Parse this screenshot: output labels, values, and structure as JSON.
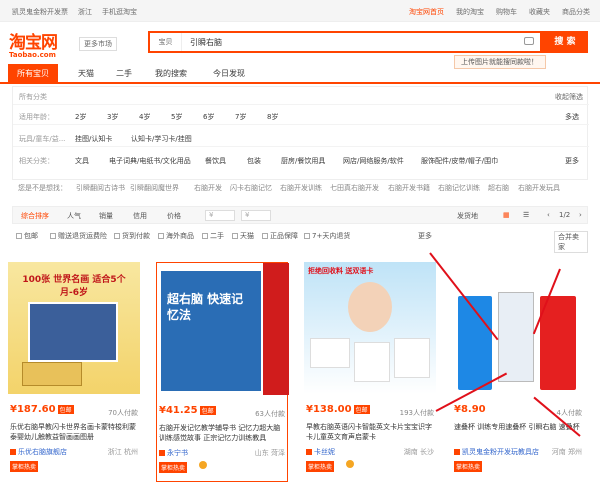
{
  "topbar": {
    "left": [
      "凯灵鬼金粉开发票",
      "浙江",
      "手机逛淘宝"
    ],
    "right": [
      "淘宝网首页",
      "我的淘宝",
      "购物车",
      "收藏夹",
      "商品分类"
    ]
  },
  "logo": {
    "main": "淘宝网",
    "sub": "Taobao.com"
  },
  "market_label": "更多市场",
  "search": {
    "category": "宝贝",
    "query": "引瞬右脑",
    "button": "搜 索"
  },
  "upload_tip": "上传图片就能搜同款啦！",
  "tabs": [
    "所有宝贝",
    "天猫",
    "二手",
    "我的搜索",
    "今日发现"
  ],
  "filter": {
    "all_label": "所有分类",
    "collapse_label": "收起筛选",
    "rows": [
      {
        "label": "适用年龄：",
        "values": [
          "2岁",
          "3岁",
          "4岁",
          "5岁",
          "6岁",
          "7岁",
          "8岁"
        ],
        "extra": "多选"
      },
      {
        "label": "玩具/童车/益...",
        "values": [
          "挂图/认知卡",
          "认知卡/学习卡/挂图"
        ],
        "extra": ""
      },
      {
        "label": "相关分类：",
        "values": [
          "文具",
          "电子词典/电纸书/文化用品",
          "餐饮具",
          "包装",
          "厨房/餐饮用具",
          "网店/网络服务/软件",
          "服饰配件/皮带/帽子/围巾"
        ],
        "extra": "更多"
      }
    ]
  },
  "guess": {
    "label": "您是不是想找：",
    "items": [
      "引瞬翻阅古诗书",
      "引瞬翻阅魔世界",
      "右脑开发",
      "闪卡右脑记忆",
      "右脑开发训练",
      "七田真右脑开发",
      "右脑开发书籍",
      "右脑记忆训练",
      "超右脑",
      "右脑开发玩具"
    ]
  },
  "sort": {
    "items": [
      "综合排序",
      "人气",
      "销量",
      "信用",
      "价格"
    ],
    "price_from": "¥",
    "price_to": "¥",
    "ship": "发货地",
    "page": "1/2"
  },
  "options": [
    "包邮",
    "赠送退货运费险",
    "货到付款",
    "海外商品",
    "二手",
    "天猫",
    "正品保障",
    "7+天内退货"
  ],
  "options_more": "更多",
  "options_merge": "合并卖家",
  "products": [
    {
      "price": "¥187.60",
      "badge": "包邮",
      "buyers": "70人付款",
      "title": "乐优右脑早教闪卡世界名画卡蒙特梭利蒙泰婴幼儿触教益智画画图册",
      "shop": "乐优右脑旗舰店",
      "loc": "浙江 杭州",
      "tag": "掌柜热卖",
      "img_text": "100张 世界名画 适合5个月-6岁",
      "color": "#f0c040"
    },
    {
      "price": "¥41.25",
      "badge": "包邮",
      "buyers": "63人付款",
      "title": "右脑开发记忆教学辅导书 记忆力超大脑训练感觉故事 正宗记忆力训练教具",
      "shop": "永宁书",
      "loc": "山东 菏泽",
      "tag": "掌柜热卖",
      "img_text": "超右脑 快速记忆法",
      "color": "#2a6db5"
    },
    {
      "price": "¥138.00",
      "badge": "包邮",
      "buyers": "193人付款",
      "title": "早教右脑英语闪卡智能英文卡片宝宝识字卡儿童英文育声启蒙卡",
      "shop": "卡丝妮",
      "loc": "湖南 长沙",
      "tag": "掌柜热卖",
      "img_text": "拒绝回收料 送双语卡",
      "color": "#4aa3df"
    },
    {
      "price": "¥8.90",
      "badge": "",
      "buyers": "4人付款",
      "title": "速叠杯 训练专用速叠杯 引瞬右脑 速叠杯",
      "shop": "凯灵鬼金粉开发玩教具店",
      "loc": "河南 郑州",
      "tag": "掌柜热卖",
      "img_text": "",
      "color": "#1e6fd9"
    }
  ],
  "colors": {
    "accent": "#ff4400",
    "arrow": "#e0101a"
  }
}
